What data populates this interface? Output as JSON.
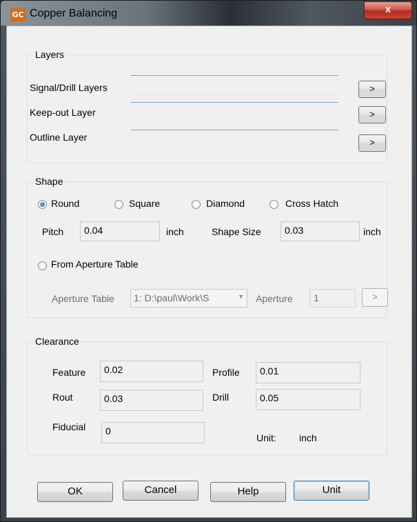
{
  "window": {
    "title": "Copper Balancing",
    "icon_text": "GC",
    "close_symbol": "x"
  },
  "layers": {
    "group_label": "Layers",
    "signal_drill_label": "Signal/Drill Layers",
    "keepout_label": "Keep-out Layer",
    "outline_label": "Outline Layer",
    "browse_label": ">"
  },
  "shape": {
    "group_label": "Shape",
    "options": [
      {
        "label": "Round",
        "checked": true
      },
      {
        "label": "Square",
        "checked": false
      },
      {
        "label": "Diamond",
        "checked": false
      },
      {
        "label": "Cross Hatch",
        "checked": false
      }
    ],
    "pitch_label": "Pitch",
    "pitch_value": "0.04",
    "pitch_unit": "inch",
    "size_label": "Shape Size",
    "size_value": "0.03",
    "size_unit": "inch",
    "from_aperture_label": "From Aperture Table",
    "aperture_table_label": "Aperture Table",
    "aperture_table_value": "1: D:\\paul\\Work\\S",
    "aperture_label": "Aperture",
    "aperture_value": "1",
    "aperture_browse_label": ">"
  },
  "clearance": {
    "group_label": "Clearance",
    "feature_label": "Feature",
    "feature_value": "0.02",
    "profile_label": "Profile",
    "profile_value": "0.01",
    "rout_label": "Rout",
    "rout_value": "0.03",
    "drill_label": "Drill",
    "drill_value": "0.05",
    "fiducial_label": "Fiducial",
    "fiducial_value": "0",
    "unit_label": "Unit:",
    "unit_value": "inch"
  },
  "buttons": {
    "ok": "OK",
    "cancel": "Cancel",
    "help": "Help",
    "unit": "Unit"
  }
}
